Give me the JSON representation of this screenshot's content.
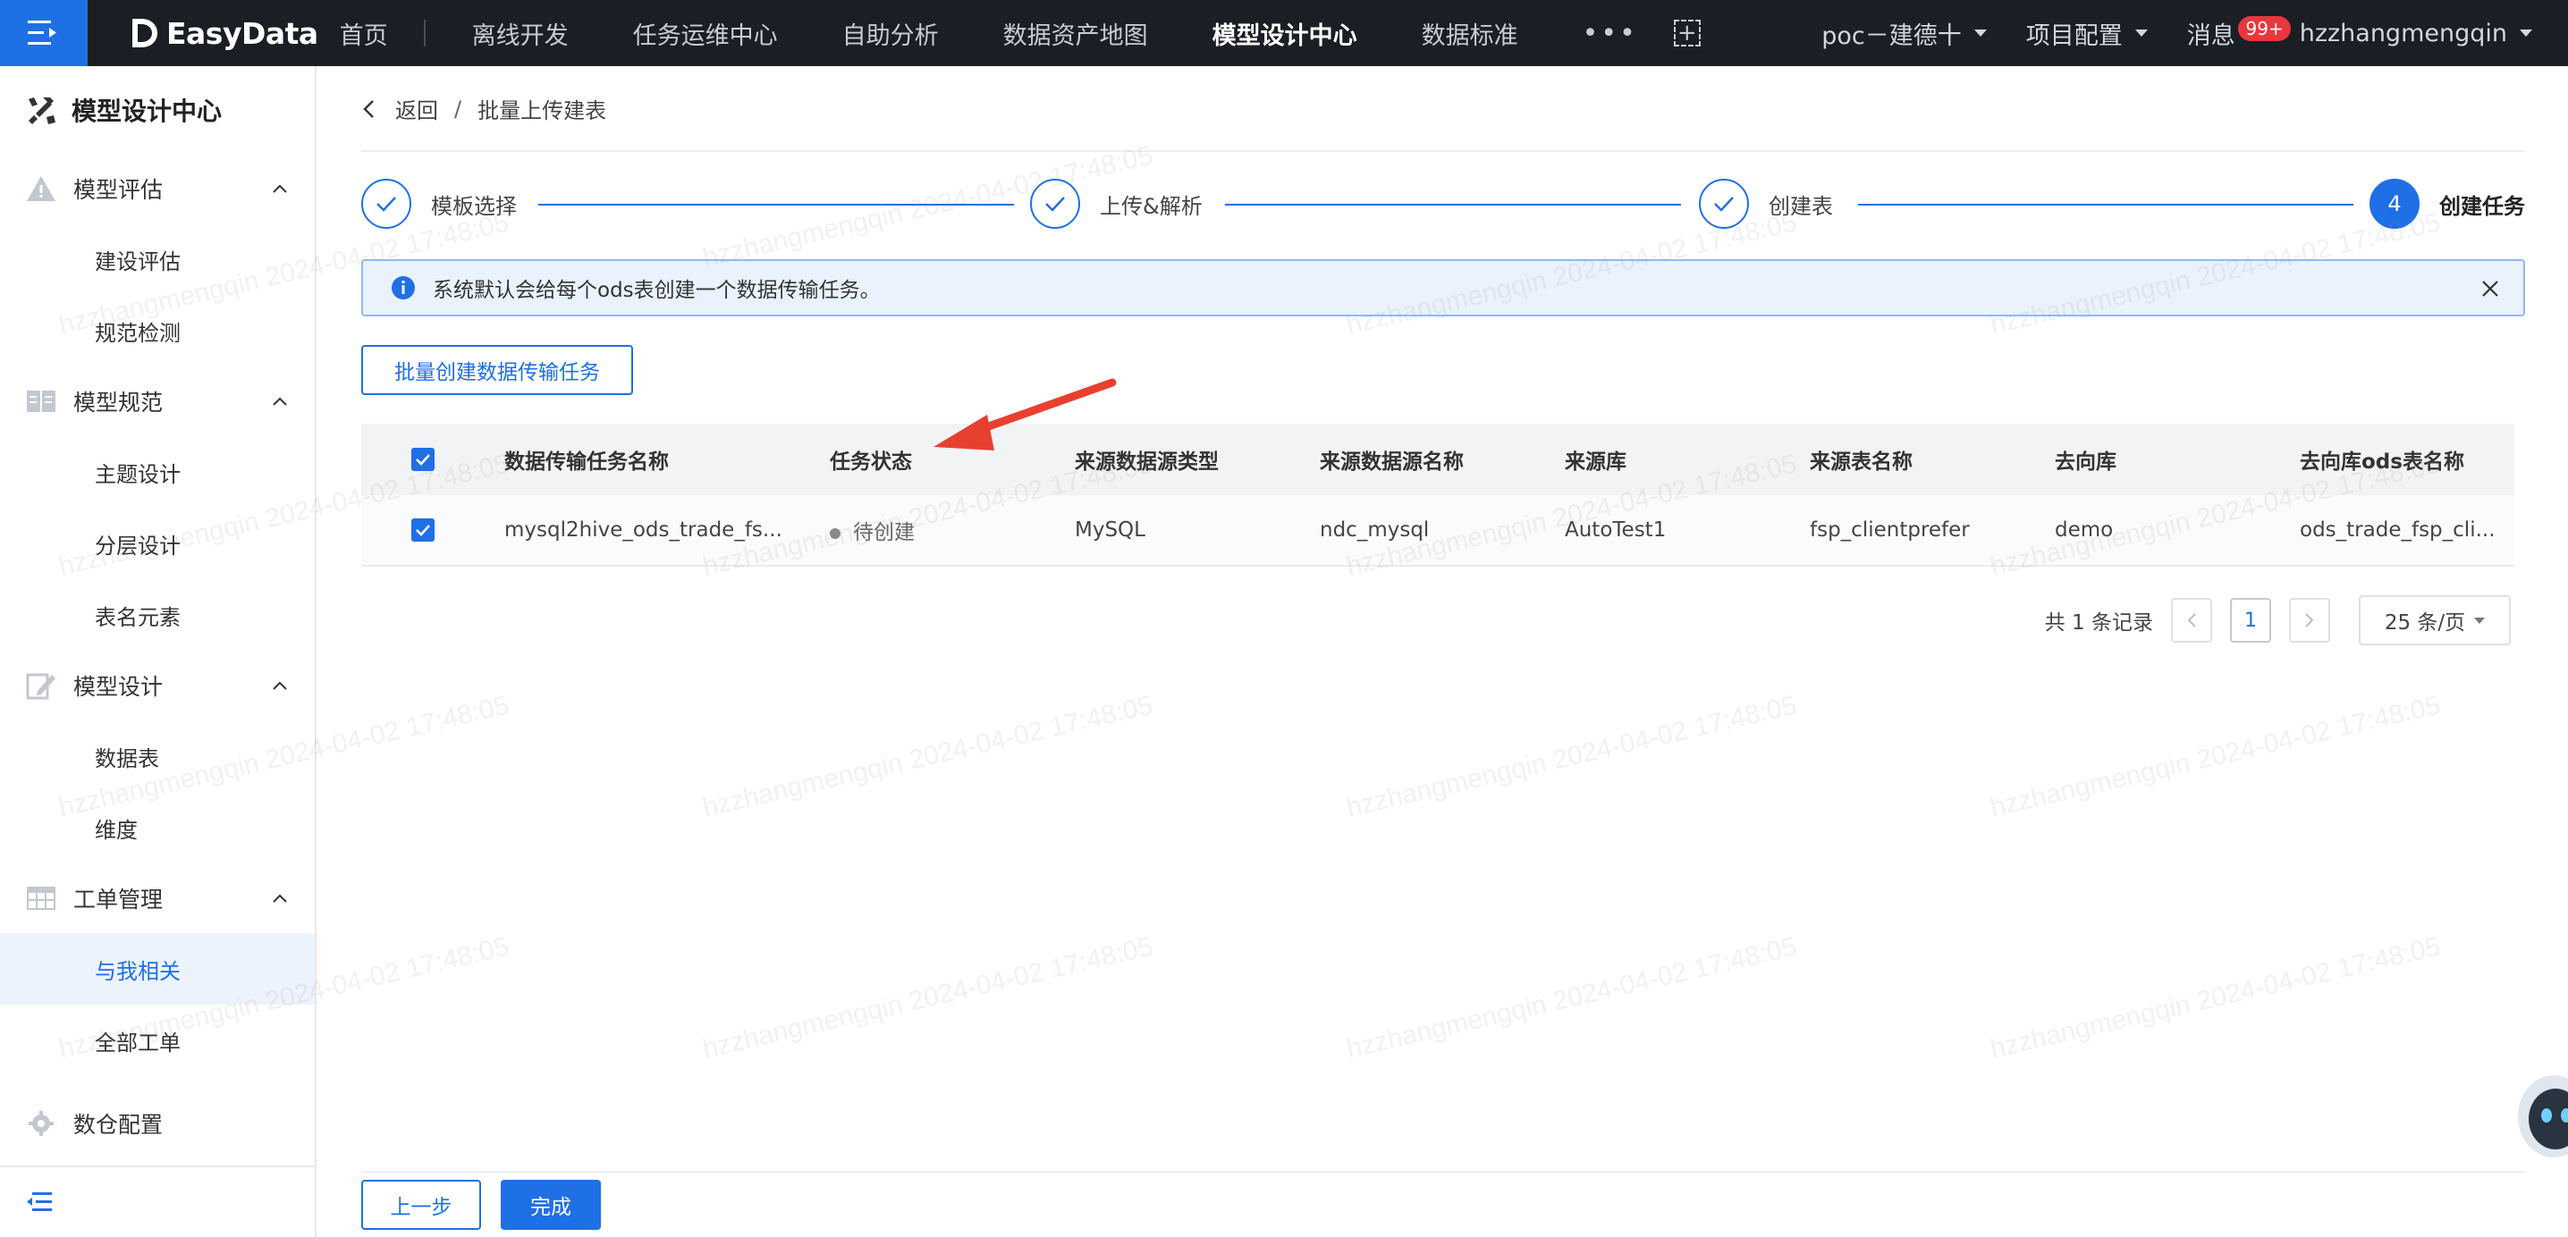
{
  "brand": {
    "name": "EasyData"
  },
  "nav": {
    "items": [
      "首页",
      "离线开发",
      "任务运维中心",
      "自助分析",
      "数据资产地图",
      "模型设计中心",
      "数据标准"
    ],
    "active_index": 5,
    "more": "•••"
  },
  "header_right": {
    "project": "poc－建德十",
    "project_config": "项目配置",
    "messages": "消息",
    "messages_badge": "99+",
    "user": "hzzhangmengqin"
  },
  "sidebar": {
    "title": "模型设计中心",
    "groups": [
      {
        "label": "模型评估",
        "items": [
          "建设评估",
          "规范检测"
        ]
      },
      {
        "label": "模型规范",
        "items": [
          "主题设计",
          "分层设计",
          "表名元素"
        ]
      },
      {
        "label": "模型设计",
        "items": [
          "数据表",
          "维度"
        ]
      },
      {
        "label": "工单管理",
        "items": [
          "与我相关",
          "全部工单"
        ]
      }
    ],
    "active_item": "与我相关",
    "bottom_group": "数仓配置"
  },
  "breadcrumb": {
    "back": "返回",
    "sep": "/",
    "current": "批量上传建表"
  },
  "steps": [
    {
      "label": "模板选择",
      "state": "done"
    },
    {
      "label": "上传&解析",
      "state": "done"
    },
    {
      "label": "创建表",
      "state": "done"
    },
    {
      "label": "创建任务",
      "state": "current",
      "number": "4"
    }
  ],
  "alert": {
    "text": "系统默认会给每个ods表创建一个数据传输任务。"
  },
  "batch_button": "批量创建数据传输任务",
  "table": {
    "columns": [
      "数据传输任务名称",
      "任务状态",
      "来源数据源类型",
      "来源数据源名称",
      "来源库",
      "来源表名称",
      "去向库",
      "去向库ods表名称"
    ],
    "rows": [
      {
        "checked": true,
        "name": "mysql2hive_ods_trade_fs...",
        "status": "待创建",
        "src_type": "MySQL",
        "src_name": "ndc_mysql",
        "src_db": "AutoTest1",
        "src_table": "fsp_clientprefer",
        "dst_db": "demo",
        "dst_table": "ods_trade_fsp_cli..."
      }
    ]
  },
  "pagination": {
    "total_text": "共 1 条记录",
    "current_page": "1",
    "page_size": "25 条/页"
  },
  "footer": {
    "prev": "上一步",
    "done": "完成"
  },
  "watermark": "hzzhangmengqin 2024-04-02 17:48:05",
  "colors": {
    "primary": "#1f6fe5",
    "topbar": "#1b1e24",
    "annotation": "#e8402f"
  }
}
